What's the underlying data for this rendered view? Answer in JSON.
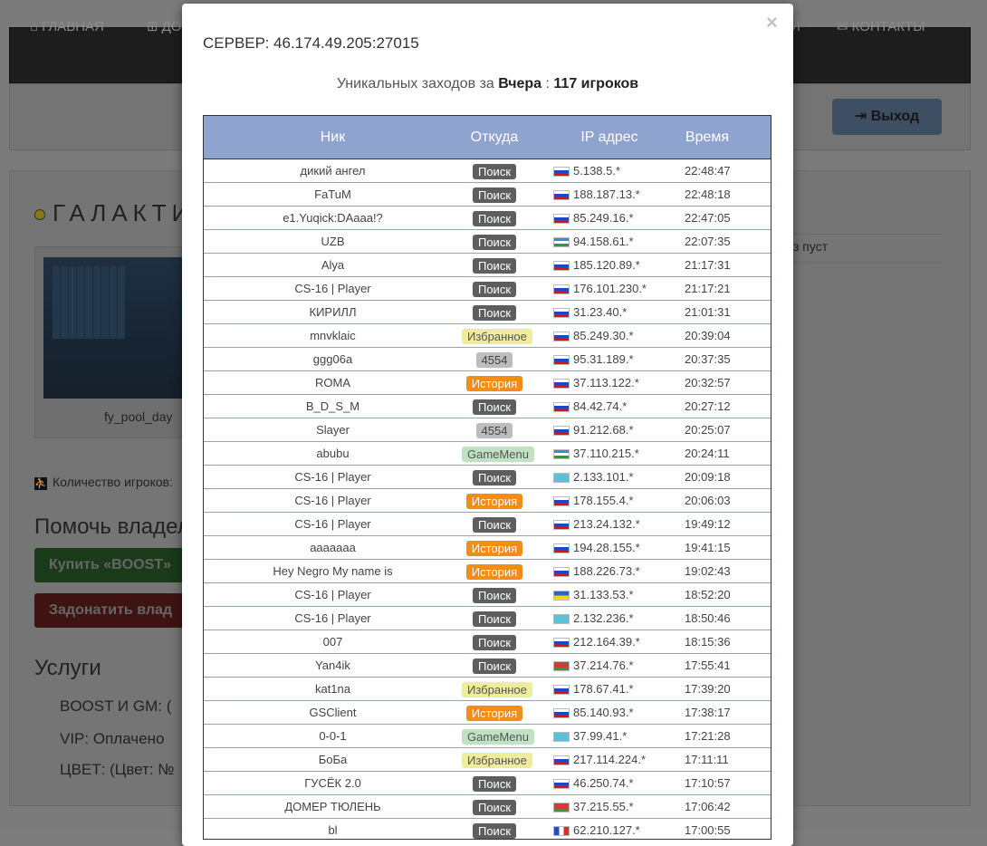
{
  "nav": {
    "items": [
      {
        "label": "ГЛАВНАЯ",
        "icon": "home-icon",
        "glyph": "⌂"
      },
      {
        "label": "ДО",
        "icon": "plus-square-icon",
        "glyph": "⊞"
      },
      {
        "label": "И",
        "icon": "",
        "glyph": ""
      },
      {
        "label": "КОНТАКТЫ",
        "icon": "envelope-icon",
        "glyph": "✉"
      }
    ],
    "logout_label": "Выход",
    "logout_icon": "sign-out-icon"
  },
  "background": {
    "server_title": "ГАЛАКТИ",
    "map_name": "fy_pool_day",
    "players_label": "Количество игроков:",
    "help_title": "Помочь владел",
    "boost_button": "Купить «BOOST»",
    "donate_button": "Задонатить влад",
    "services_title": "Услуги",
    "services": [
      "BOOST И GM:   (",
      "VIP:   Оплачено",
      "ЦВЕТ:   (Цвет: №"
    ],
    "right_text": "з пуст"
  },
  "modal": {
    "title": "СЕРВЕР: 46.174.49.205:27015",
    "close_glyph": "×",
    "unique_prefix": "Уникальных заходов за",
    "unique_day": "Вчера",
    "unique_sep": ":",
    "unique_count": "117 игроков",
    "columns": [
      "Ник",
      "Откуда",
      "IP адрес",
      "Время"
    ],
    "rows": [
      {
        "nick": "дикий ангел",
        "from": "Поиск",
        "type": "search",
        "flag": "ru",
        "ip": "5.138.5.*",
        "time": "22:48:47"
      },
      {
        "nick": "FaTuM",
        "from": "Поиск",
        "type": "search",
        "flag": "ru",
        "ip": "188.187.13.*",
        "time": "22:48:18"
      },
      {
        "nick": "e1.Yuqick:DAaaa!?",
        "from": "Поиск",
        "type": "search",
        "flag": "ru",
        "ip": "85.249.16.*",
        "time": "22:47:05"
      },
      {
        "nick": "UZB",
        "from": "Поиск",
        "type": "search",
        "flag": "uz",
        "ip": "94.158.61.*",
        "time": "22:07:35"
      },
      {
        "nick": "Alya",
        "from": "Поиск",
        "type": "search",
        "flag": "ru",
        "ip": "185.120.89.*",
        "time": "21:17:31"
      },
      {
        "nick": "CS-16 | Player",
        "from": "Поиск",
        "type": "search",
        "flag": "ru",
        "ip": "176.101.230.*",
        "time": "21:17:21"
      },
      {
        "nick": "КИРИЛЛ",
        "from": "Поиск",
        "type": "search",
        "flag": "ru",
        "ip": "31.23.40.*",
        "time": "21:01:31"
      },
      {
        "nick": "mnvklaic",
        "from": "Избранное",
        "type": "fav",
        "flag": "ru",
        "ip": "85.249.30.*",
        "time": "20:39:04"
      },
      {
        "nick": "ggg06a",
        "from": "4554",
        "type": "num",
        "flag": "ru",
        "ip": "95.31.189.*",
        "time": "20:37:35"
      },
      {
        "nick": "ROMA",
        "from": "История",
        "type": "hist",
        "flag": "ru",
        "ip": "37.113.122.*",
        "time": "20:32:57"
      },
      {
        "nick": "B_D_S_M",
        "from": "Поиск",
        "type": "search",
        "flag": "ru",
        "ip": "84.42.74.*",
        "time": "20:27:12"
      },
      {
        "nick": "Slayer",
        "from": "4554",
        "type": "num",
        "flag": "ru",
        "ip": "91.212.68.*",
        "time": "20:25:07"
      },
      {
        "nick": "abubu",
        "from": "GameMenu",
        "type": "gm",
        "flag": "uz",
        "ip": "37.110.215.*",
        "time": "20:24:11"
      },
      {
        "nick": "CS-16 | Player",
        "from": "Поиск",
        "type": "search",
        "flag": "kz",
        "ip": "2.133.101.*",
        "time": "20:09:18"
      },
      {
        "nick": "CS-16 | Player",
        "from": "История",
        "type": "hist",
        "flag": "ru",
        "ip": "178.155.4.*",
        "time": "20:06:03"
      },
      {
        "nick": "CS-16 | Player",
        "from": "Поиск",
        "type": "search",
        "flag": "ru",
        "ip": "213.24.132.*",
        "time": "19:49:12"
      },
      {
        "nick": "aaaaaaa",
        "from": "История",
        "type": "hist",
        "flag": "ru",
        "ip": "194.28.155.*",
        "time": "19:41:15"
      },
      {
        "nick": "Hey Negro My name is",
        "from": "История",
        "type": "hist",
        "flag": "ru",
        "ip": "188.226.73.*",
        "time": "19:02:43"
      },
      {
        "nick": "CS-16 | Player",
        "from": "Поиск",
        "type": "search",
        "flag": "ua",
        "ip": "31.133.53.*",
        "time": "18:52:20"
      },
      {
        "nick": "CS-16 | Player",
        "from": "Поиск",
        "type": "search",
        "flag": "kz",
        "ip": "2.132.236.*",
        "time": "18:50:46"
      },
      {
        "nick": "007",
        "from": "Поиск",
        "type": "search",
        "flag": "ru",
        "ip": "212.164.39.*",
        "time": "18:15:36"
      },
      {
        "nick": "Yan4ik",
        "from": "Поиск",
        "type": "search",
        "flag": "by",
        "ip": "37.214.76.*",
        "time": "17:55:41"
      },
      {
        "nick": "kat1na",
        "from": "Избранное",
        "type": "fav",
        "flag": "ru",
        "ip": "178.67.41.*",
        "time": "17:39:20"
      },
      {
        "nick": "GSClient",
        "from": "История",
        "type": "hist",
        "flag": "ru",
        "ip": "85.140.93.*",
        "time": "17:38:17"
      },
      {
        "nick": "0-0-1",
        "from": "GameMenu",
        "type": "gm",
        "flag": "kz",
        "ip": "37.99.41.*",
        "time": "17:21:28"
      },
      {
        "nick": "БоБа",
        "from": "Избранное",
        "type": "fav",
        "flag": "ru",
        "ip": "217.114.224.*",
        "time": "17:11:11"
      },
      {
        "nick": "ГУСЁК 2.0",
        "from": "Поиск",
        "type": "search",
        "flag": "ru",
        "ip": "46.250.74.*",
        "time": "17:10:57"
      },
      {
        "nick": "ДОМЕР ТЮЛЕНЬ",
        "from": "Поиск",
        "type": "search",
        "flag": "by",
        "ip": "37.215.55.*",
        "time": "17:06:42"
      },
      {
        "nick": "bl",
        "from": "Поиск",
        "type": "search",
        "flag": "fr",
        "ip": "62.210.127.*",
        "time": "17:00:55"
      }
    ]
  }
}
